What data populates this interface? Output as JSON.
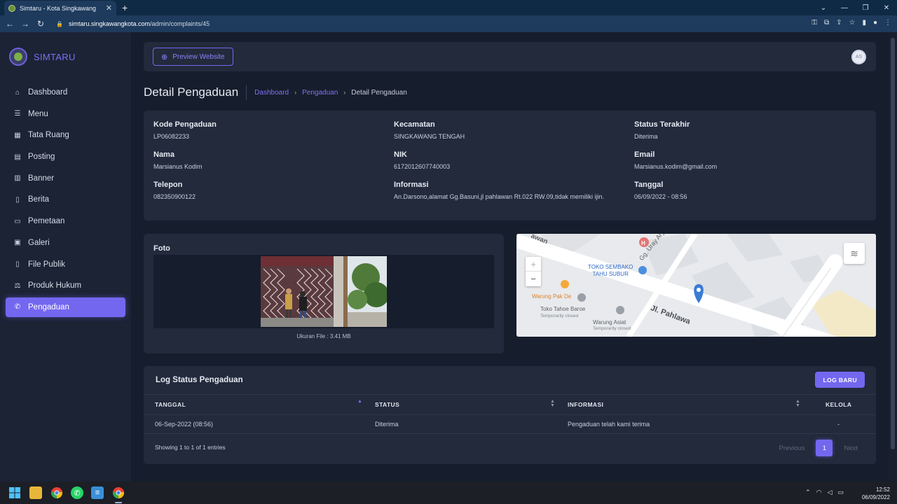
{
  "browser": {
    "tab_title": "Simtaru - Kota Singkawang",
    "url_host": "simtaru.singkawangkota.com",
    "url_path": "/admin/complaints/45"
  },
  "sidebar": {
    "brand": "SIMTARU",
    "items": [
      {
        "label": "Dashboard",
        "icon": "home-icon"
      },
      {
        "label": "Menu",
        "icon": "menu-icon"
      },
      {
        "label": "Tata Ruang",
        "icon": "building-icon"
      },
      {
        "label": "Posting",
        "icon": "clipboard-icon"
      },
      {
        "label": "Banner",
        "icon": "columns-icon"
      },
      {
        "label": "Berita",
        "icon": "file-icon"
      },
      {
        "label": "Pemetaan",
        "icon": "map-icon"
      },
      {
        "label": "Galeri",
        "icon": "image-icon"
      },
      {
        "label": "File Publik",
        "icon": "file-text-icon"
      },
      {
        "label": "Produk Hukum",
        "icon": "scale-icon"
      },
      {
        "label": "Pengaduan",
        "icon": "megaphone-icon",
        "active": true
      }
    ]
  },
  "topnav": {
    "preview_label": "Preview Website",
    "avatar_initials": "AS"
  },
  "page": {
    "title": "Detail Pengaduan",
    "breadcrumb": [
      "Dashboard",
      "Pengaduan",
      "Detail Pengaduan"
    ]
  },
  "detail": {
    "kode_label": "Kode Pengaduan",
    "kode_value": "LP06082233",
    "kecamatan_label": "Kecamatan",
    "kecamatan_value": "SINGKAWANG TENGAH",
    "status_label": "Status Terakhir",
    "status_value": "Diterima",
    "nama_label": "Nama",
    "nama_value": "Marsianus Kodim",
    "nik_label": "NIK",
    "nik_value": "6172012607740003",
    "email_label": "Email",
    "email_value": "Marsianus.kodim@gmail.com",
    "telepon_label": "Telepon",
    "telepon_value": "082350900122",
    "informasi_label": "Informasi",
    "informasi_value": "An.Darsono,alamat Gg.Basuni,jl pahlawan Rt.022 RW.09,tidak memiliki ijin.",
    "tanggal_label": "Tanggal",
    "tanggal_value": "06/09/2022 - 08:56"
  },
  "photo": {
    "title": "Foto",
    "caption": "Ukuran File : 3.41 MB"
  },
  "map": {
    "labels": {
      "awan": "awan",
      "sembako": "TOKO SEMBAKO",
      "tahu": "TAHU SUBUR",
      "uray": "Gg. Uray Arya",
      "pakde": "Warung Pak De",
      "tahoe": "Toko Tahoe Baroe",
      "tahoe_status": "Temporarily closed",
      "asiat": "Warung Asiat",
      "asiat_status": "Temporarily closed",
      "pahlawan": "Jl. Pahlawa",
      "zoom_in": "+",
      "zoom_out": "−"
    }
  },
  "log": {
    "title": "Log Status Pengaduan",
    "new_button": "LOG BARU",
    "columns": [
      "TANGGAL",
      "STATUS",
      "INFORMASI",
      "KELOLA"
    ],
    "rows": [
      {
        "tanggal": "06-Sep-2022 (08:56)",
        "status": "Diterima",
        "informasi": "Pengaduan telah kami terima",
        "kelola": "-"
      }
    ],
    "showing": "Showing 1 to 1 of 1 entries",
    "prev": "Previous",
    "page": "1",
    "next": "Next"
  },
  "taskbar": {
    "time": "12:52",
    "date": "06/09/2022"
  },
  "colors": {
    "accent": "#7367f0",
    "background": "#161d2c",
    "card": "#222a3c",
    "sidebar": "#1b2335"
  }
}
